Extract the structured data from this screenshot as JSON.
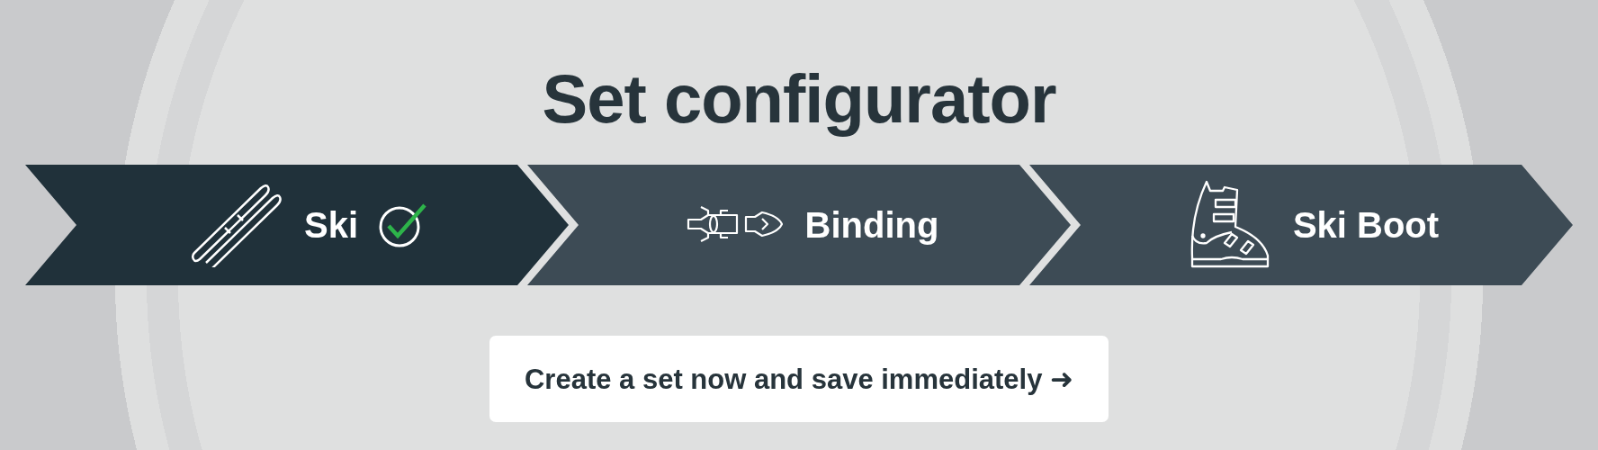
{
  "title": "Set configurator",
  "steps": [
    {
      "label": "Ski",
      "kind": "ski",
      "selected": true,
      "completed": true
    },
    {
      "label": "Binding",
      "kind": "binding",
      "selected": false,
      "completed": false
    },
    {
      "label": "Ski Boot",
      "kind": "boot",
      "selected": false,
      "completed": false
    }
  ],
  "cta": {
    "label": "Create a set now and save immediately ➜"
  }
}
